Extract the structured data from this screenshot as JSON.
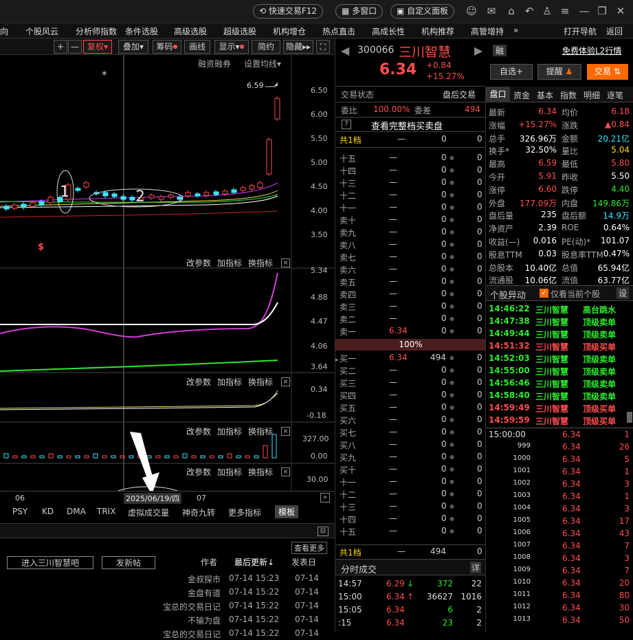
{
  "topbar": {
    "quick_trade": "快速交易F12",
    "multi_window": "多窗口",
    "custom_panel": "自定义面板"
  },
  "menu": [
    "向",
    "个股风云",
    "分析师指数",
    "条件选股",
    "高级选股",
    "超级选股",
    "机构增仓",
    "热点直击",
    "高成长性",
    "机构推荐",
    "高管增持",
    "»"
  ],
  "menu_right": [
    "打开导航",
    "返回"
  ],
  "chart_toolbar": {
    "plus": "+",
    "minus": "—",
    "fuquan": "复权",
    "diejia": "叠加",
    "chouma": "筹码",
    "huaxian": "画线",
    "xianshi": "显示",
    "jianyue": "简约",
    "yincang": "隐藏"
  },
  "main_panel": {
    "rzrq": "融资融券",
    "ma_setting": "设置均线",
    "annot1": "1",
    "annot2": "2",
    "peak_label": "6.59",
    "star": "*",
    "dollar": "$"
  },
  "price_axis": [
    "6.50",
    "6.00",
    "5.50",
    "5.00",
    "4.50",
    "4.00",
    "3.50"
  ],
  "sub_actions": {
    "gaicanshu": "改参数",
    "jiazhibiao": "加指标",
    "huanzhibiao": "换指标",
    "close": "×"
  },
  "sub1_axis": [
    "5.34",
    "4.88",
    "4.47",
    "4.06",
    "3.64"
  ],
  "sub2_axis": [
    "0.34",
    "-0.18"
  ],
  "sub3_axis": [
    "327.00",
    "0.00"
  ],
  "sub4_axis": [
    "30.00"
  ],
  "date_axis": {
    "left": "06",
    "cursor": "2025/06/19/四",
    "right": "07"
  },
  "indicator_tabs": [
    "PSY",
    "KD",
    "DMA",
    "TRIX",
    "虚拟成交量",
    "神奇九转",
    "更多指标",
    "模板"
  ],
  "forum": {
    "enter_btn": "进入三川智慧吧",
    "post_btn": "发新帖",
    "more": "查看更多",
    "col_author": "作者",
    "col_updated": "最后更新↓",
    "col_posted": "发表日",
    "posts": [
      {
        "title": "金叔探市",
        "updated": "07-14 15:23",
        "posted": "07-14"
      },
      {
        "title": "金盘有道",
        "updated": "07-14 15:22",
        "posted": "07-14"
      },
      {
        "title": "宝总的交易日记",
        "updated": "07-14 15:22",
        "posted": "07-14"
      },
      {
        "title": "不输为盘",
        "updated": "07-14 15:22",
        "posted": "07-14"
      },
      {
        "title": "宝总的交易日记",
        "updated": "07-14 15:22",
        "posted": "07-14"
      }
    ]
  },
  "stock": {
    "code": "300066",
    "name": "三川智慧",
    "rong": "融",
    "l2_link": "免费体验L2行情",
    "price": "6.34",
    "change": "+0.84",
    "change_pct": "+15.27%",
    "btn_watch": "自选+",
    "btn_alert": "提醒",
    "btn_trade": "交易"
  },
  "orderbook": {
    "status_label": "交易状态",
    "status_value": "盘后交易",
    "weibi_label": "委比",
    "weibi": "100.00%",
    "weicha_label": "委差",
    "weicha": "494",
    "full_depth": "查看完整档买卖盘",
    "total_label": "共1档",
    "total_dash": "—",
    "total_v1": "0",
    "total_v2": "0",
    "mid_pct": "100%",
    "sells": [
      {
        "label": "十五",
        "price": "—",
        "vol": "0",
        "x": "0"
      },
      {
        "label": "十四",
        "price": "—",
        "vol": "0",
        "x": "0"
      },
      {
        "label": "十三",
        "price": "—",
        "vol": "0",
        "x": "0"
      },
      {
        "label": "十二",
        "price": "—",
        "vol": "0",
        "x": "0"
      },
      {
        "label": "十一",
        "price": "—",
        "vol": "0",
        "x": "0"
      },
      {
        "label": "卖十",
        "price": "—",
        "vol": "0",
        "x": "0"
      },
      {
        "label": "卖九",
        "price": "—",
        "vol": "0",
        "x": "0"
      },
      {
        "label": "卖八",
        "price": "—",
        "vol": "0",
        "x": "0"
      },
      {
        "label": "卖七",
        "price": "—",
        "vol": "0",
        "x": "0"
      },
      {
        "label": "卖六",
        "price": "—",
        "vol": "0",
        "x": "0"
      },
      {
        "label": "卖五",
        "price": "—",
        "vol": "0",
        "x": "0"
      },
      {
        "label": "卖四",
        "price": "—",
        "vol": "0",
        "x": "0"
      },
      {
        "label": "卖三",
        "price": "—",
        "vol": "0",
        "x": "0"
      },
      {
        "label": "卖二",
        "price": "—",
        "vol": "0",
        "x": "0"
      },
      {
        "label": "卖一",
        "price": "6.34",
        "vol": "0",
        "x": "0"
      }
    ],
    "buys": [
      {
        "label": "买一",
        "price": "6.34",
        "vol": "494",
        "x": "0"
      },
      {
        "label": "买二",
        "price": "—",
        "vol": "0",
        "x": "0"
      },
      {
        "label": "买三",
        "price": "—",
        "vol": "0",
        "x": "0"
      },
      {
        "label": "买四",
        "price": "—",
        "vol": "0",
        "x": "0"
      },
      {
        "label": "买五",
        "price": "—",
        "vol": "0",
        "x": "0"
      },
      {
        "label": "买六",
        "price": "—",
        "vol": "0",
        "x": "0"
      },
      {
        "label": "买七",
        "price": "—",
        "vol": "0",
        "x": "0"
      },
      {
        "label": "买八",
        "price": "—",
        "vol": "0",
        "x": "0"
      },
      {
        "label": "买九",
        "price": "—",
        "vol": "0",
        "x": "0"
      },
      {
        "label": "买十",
        "price": "—",
        "vol": "0",
        "x": "0"
      },
      {
        "label": "十一",
        "price": "—",
        "vol": "0",
        "x": "0"
      },
      {
        "label": "十二",
        "price": "—",
        "vol": "0",
        "x": "0"
      },
      {
        "label": "十三",
        "price": "—",
        "vol": "0",
        "x": "0"
      },
      {
        "label": "十四",
        "price": "—",
        "vol": "0",
        "x": "0"
      },
      {
        "label": "十五",
        "price": "—",
        "vol": "0",
        "x": "0"
      }
    ],
    "bottom_total_label": "共1档",
    "bottom_total_dash": "—",
    "bottom_total_v1": "494",
    "bottom_total_v2": "0"
  },
  "fenshi": {
    "title": "分时成交",
    "detail": "详",
    "rows": [
      {
        "time": "14:57",
        "price": "6.29",
        "arrow": "↓",
        "vol": "372",
        "n": "22"
      },
      {
        "time": "15:00",
        "price": "6.34",
        "arrow": "↑",
        "vol": "36627",
        "n": "1016"
      },
      {
        "time": "15:05",
        "price": "6.34",
        "arrow": "",
        "vol": "6",
        "n": "2"
      },
      {
        "time": ":15",
        "price": "6.34",
        "arrow": "",
        "vol": "23",
        "n": "2"
      }
    ]
  },
  "quote_tabs": [
    "盘口",
    "资金",
    "基本",
    "指数",
    "明细",
    "逐笔"
  ],
  "quote": [
    {
      "l1": "最新",
      "v1": "6.34",
      "c1": "red",
      "l2": "均价",
      "v2": "6.18",
      "c2": "red"
    },
    {
      "l1": "涨幅",
      "v1": "+15.27%",
      "c1": "red",
      "l2": "涨跌",
      "v2": "▲0.84",
      "c2": "red"
    },
    {
      "l1": "总手",
      "v1": "326.96万",
      "c1": "wht",
      "l2": "金额",
      "v2": "20.21亿",
      "c2": "cy"
    },
    {
      "l1": "换手*",
      "v1": "32.50%",
      "c1": "wht",
      "l2": "量比",
      "v2": "5.04",
      "c2": "yel"
    },
    {
      "l1": "最高",
      "v1": "6.59",
      "c1": "red",
      "l2": "最低",
      "v2": "5.80",
      "c2": "red"
    },
    {
      "l1": "今开",
      "v1": "5.91",
      "c1": "red",
      "l2": "昨收",
      "v2": "5.50",
      "c2": "wht"
    },
    {
      "l1": "涨停",
      "v1": "6.60",
      "c1": "red",
      "l2": "跌停",
      "v2": "4.40",
      "c2": "grn"
    },
    {
      "l1": "外盘",
      "v1": "177.09万",
      "c1": "red",
      "l2": "内盘",
      "v2": "149.86万",
      "c2": "grn"
    },
    {
      "l1": "盘后量",
      "v1": "235",
      "c1": "wht",
      "l2": "盘后额",
      "v2": "14.9万",
      "c2": "cy"
    },
    {
      "l1": "净资产",
      "v1": "2.39",
      "c1": "wht",
      "l2": "ROE",
      "v2": "0.64%",
      "c2": "wht"
    },
    {
      "l1": "收益(—)",
      "v1": "0.016",
      "c1": "wht",
      "l2": "PE(动)*",
      "v2": "101.07",
      "c2": "wht"
    },
    {
      "l1": "股息TTM",
      "v1": "0.03",
      "c1": "wht",
      "l2": "股息率TTM",
      "v2": "0.47%",
      "c2": "wht"
    },
    {
      "l1": "总股本",
      "v1": "10.40亿",
      "c1": "wht",
      "l2": "总值",
      "v2": "65.94亿",
      "c2": "wht"
    },
    {
      "l1": "流通股",
      "v1": "10.06亿",
      "c1": "wht",
      "l2": "流值",
      "v2": "63.77亿",
      "c2": "wht"
    }
  ],
  "alerts": {
    "title": "个股异动",
    "only_current": "仅看当前个股",
    "settings": "设",
    "rows": [
      {
        "time": "14:46:22",
        "name": "三川智慧",
        "type": "高台跳水",
        "color": "grn"
      },
      {
        "time": "14:47:38",
        "name": "三川智慧",
        "type": "顶级卖单",
        "color": "grn"
      },
      {
        "time": "14:49:44",
        "name": "三川智慧",
        "type": "顶级卖单",
        "color": "grn"
      },
      {
        "time": "14:51:32",
        "name": "三川智慧",
        "type": "顶级买单",
        "color": "red"
      },
      {
        "time": "14:52:03",
        "name": "三川智慧",
        "type": "顶级卖单",
        "color": "grn"
      },
      {
        "time": "14:55:00",
        "name": "三川智慧",
        "type": "顶级卖单",
        "color": "grn"
      },
      {
        "time": "14:56:46",
        "name": "三川智慧",
        "type": "顶级卖单",
        "color": "grn"
      },
      {
        "time": "14:58:40",
        "name": "三川智慧",
        "type": "顶级卖单",
        "color": "grn"
      },
      {
        "time": "14:59:49",
        "name": "三川智慧",
        "type": "顶级买单",
        "color": "red"
      },
      {
        "time": "14:59:59",
        "name": "三川智慧",
        "type": "顶级买单",
        "color": "red"
      }
    ]
  },
  "ticks": [
    {
      "t": "15:00:00",
      "p": "6.34",
      "v": "1"
    },
    {
      "t": "999",
      "p": "6.34",
      "v": "26"
    },
    {
      "t": "1000",
      "p": "6.34",
      "v": "5"
    },
    {
      "t": "1001",
      "p": "6.34",
      "v": "1"
    },
    {
      "t": "1002",
      "p": "6.34",
      "v": "3"
    },
    {
      "t": "1003",
      "p": "6.34",
      "v": "1"
    },
    {
      "t": "1004",
      "p": "6.34",
      "v": "3"
    },
    {
      "t": "1005",
      "p": "6.34",
      "v": "17"
    },
    {
      "t": "1006",
      "p": "6.34",
      "v": "43"
    },
    {
      "t": "1007",
      "p": "6.34",
      "v": "7"
    },
    {
      "t": "1008",
      "p": "6.34",
      "v": "3"
    },
    {
      "t": "1009",
      "p": "6.34",
      "v": "7"
    },
    {
      "t": "1010",
      "p": "6.34",
      "v": "20"
    },
    {
      "t": "1011",
      "p": "6.34",
      "v": "80"
    },
    {
      "t": "1012",
      "p": "6.34",
      "v": "30"
    },
    {
      "t": "1013",
      "p": "6.34",
      "v": "50"
    }
  ],
  "colors": {
    "up": "#ff4d4d",
    "down": "#2eea2e",
    "accent": "#ff6a00",
    "bg": "#000000"
  }
}
